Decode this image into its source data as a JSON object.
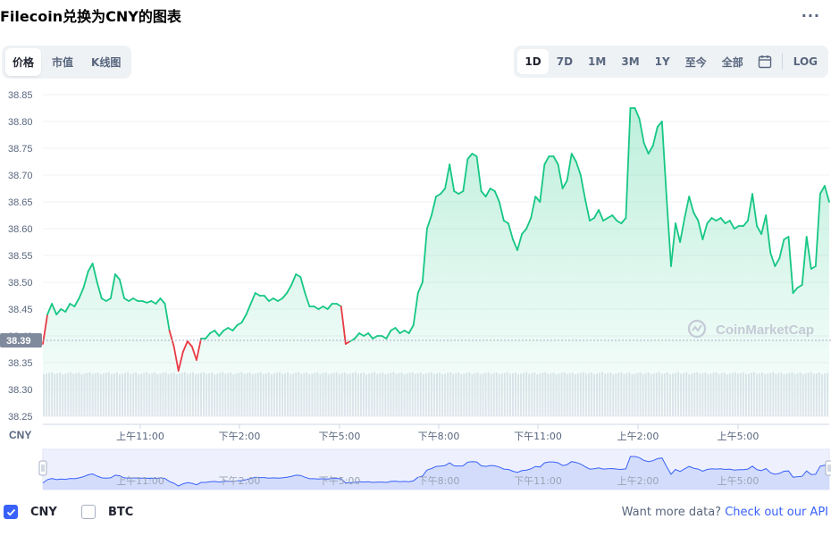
{
  "title": "Filecoin兑换为CNY的图表",
  "more_icon": "more-horizontal-icon",
  "view_tabs": [
    {
      "label": "价格",
      "active": true
    },
    {
      "label": "市值",
      "active": false
    },
    {
      "label": "K线图",
      "active": false
    }
  ],
  "range_tabs": [
    {
      "label": "1D",
      "active": true
    },
    {
      "label": "7D",
      "active": false
    },
    {
      "label": "1M",
      "active": false
    },
    {
      "label": "3M",
      "active": false
    },
    {
      "label": "1Y",
      "active": false
    },
    {
      "label": "至今",
      "active": false
    },
    {
      "label": "全部",
      "active": false
    }
  ],
  "calendar_icon": "calendar-icon",
  "log_label": "LOG",
  "currency_label": "CNY",
  "current_price_label": "38.39",
  "watermark": "CoinMarketCap",
  "legend": [
    {
      "label": "CNY",
      "checked": true
    },
    {
      "label": "BTC",
      "checked": false
    }
  ],
  "more_data": {
    "text": "Want more data?",
    "link": "Check out our API"
  },
  "colors": {
    "up": "#16c784",
    "down": "#ea3943",
    "accent": "#3861fb",
    "navigator": "#3861fb"
  },
  "chart_data": {
    "type": "area",
    "ylim": [
      38.25,
      38.85
    ],
    "yticks": [
      "38.85",
      "38.80",
      "38.75",
      "38.70",
      "38.65",
      "38.60",
      "38.55",
      "38.50",
      "38.45",
      "38.40",
      "38.35",
      "38.30",
      "38.25"
    ],
    "xticks": [
      "上午11:00",
      "下午2:00",
      "下午5:00",
      "下午8:00",
      "下午11:00",
      "上午2:00",
      "上午5:00"
    ],
    "baseline": 38.39,
    "series": [
      {
        "values": [
          38.385,
          38.44,
          38.46,
          38.44,
          38.45,
          38.445,
          38.46,
          38.455,
          38.47,
          38.49,
          38.52,
          38.535,
          38.5,
          38.47,
          38.465,
          38.47,
          38.515,
          38.505,
          38.47,
          38.465,
          38.47,
          38.465,
          38.465,
          38.462,
          38.465,
          38.46,
          38.47,
          38.46,
          38.41,
          38.38,
          38.335,
          38.37,
          38.39,
          38.38,
          38.355,
          38.395,
          38.395,
          38.405,
          38.41,
          38.4,
          38.41,
          38.415,
          38.41,
          38.42,
          38.425,
          38.44,
          38.46,
          38.48,
          38.475,
          38.475,
          38.465,
          38.47,
          38.465,
          38.47,
          38.48,
          38.495,
          38.515,
          38.51,
          38.48,
          38.455,
          38.455,
          38.45,
          38.455,
          38.45,
          38.46,
          38.46,
          38.455,
          38.385,
          38.39,
          38.395,
          38.405,
          38.4,
          38.405,
          38.395,
          38.4,
          38.4,
          38.395,
          38.41,
          38.415,
          38.405,
          38.41,
          38.405,
          38.42,
          38.48,
          38.5,
          38.6,
          38.625,
          38.66,
          38.665,
          38.675,
          38.72,
          38.67,
          38.665,
          38.67,
          38.73,
          38.74,
          38.735,
          38.67,
          38.66,
          38.675,
          38.67,
          38.65,
          38.615,
          38.61,
          38.58,
          38.56,
          38.59,
          38.6,
          38.62,
          38.66,
          38.65,
          38.72,
          38.735,
          38.735,
          38.72,
          38.675,
          38.69,
          38.74,
          38.725,
          38.7,
          38.655,
          38.615,
          38.62,
          38.635,
          38.615,
          38.62,
          38.625,
          38.615,
          38.61,
          38.62,
          38.825,
          38.825,
          38.805,
          38.76,
          38.74,
          38.755,
          38.79,
          38.8,
          38.66,
          38.53,
          38.61,
          38.575,
          38.62,
          38.66,
          38.63,
          38.615,
          38.58,
          38.61,
          38.62,
          38.615,
          38.62,
          38.61,
          38.615,
          38.6,
          38.605,
          38.605,
          38.615,
          38.665,
          38.605,
          38.59,
          38.625,
          38.555,
          38.53,
          38.545,
          38.58,
          38.585,
          38.48,
          38.49,
          38.495,
          38.585,
          38.525,
          38.53,
          38.665,
          38.68,
          38.65
        ]
      }
    ]
  }
}
